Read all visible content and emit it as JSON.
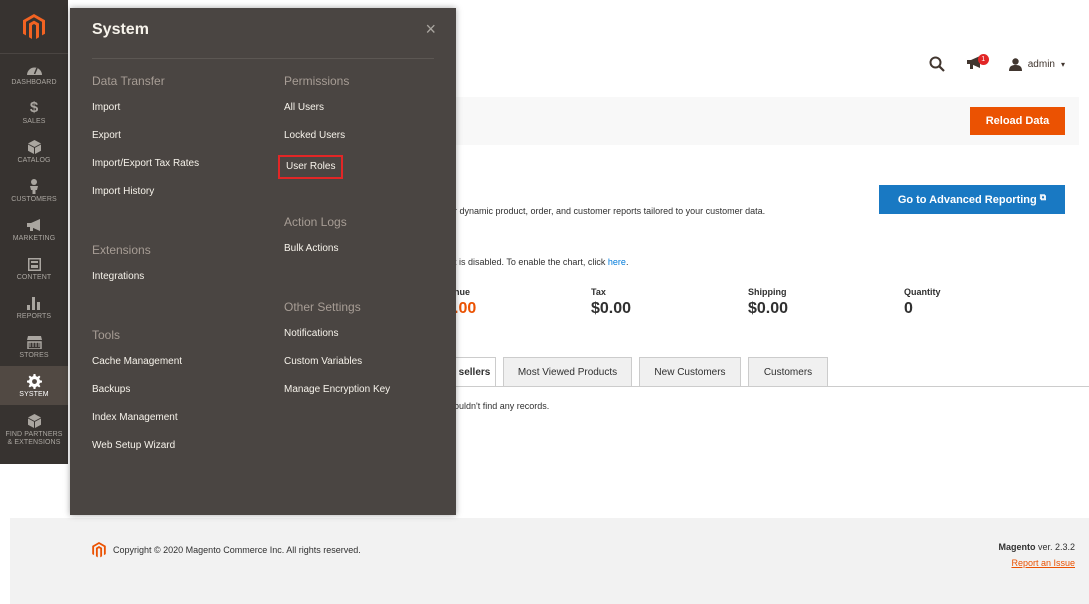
{
  "nav": {
    "items": [
      {
        "label": "DASHBOARD"
      },
      {
        "label": "SALES"
      },
      {
        "label": "CATALOG"
      },
      {
        "label": "CUSTOMERS"
      },
      {
        "label": "MARKETING"
      },
      {
        "label": "CONTENT"
      },
      {
        "label": "REPORTS"
      },
      {
        "label": "STORES"
      },
      {
        "label": "SYSTEM"
      },
      {
        "label": "FIND PARTNERS & EXTENSIONS"
      }
    ],
    "sales_glyph": "$"
  },
  "flyout": {
    "title": "System",
    "close_glyph": "×",
    "col1": {
      "data_transfer": {
        "title": "Data Transfer",
        "links": [
          "Import",
          "Export",
          "Import/Export Tax Rates",
          "Import History"
        ]
      },
      "extensions": {
        "title": "Extensions",
        "links": [
          "Integrations"
        ]
      },
      "tools": {
        "title": "Tools",
        "links": [
          "Cache Management",
          "Backups",
          "Index Management",
          "Web Setup Wizard"
        ]
      }
    },
    "col2": {
      "permissions": {
        "title": "Permissions",
        "links": [
          "All Users",
          "Locked Users",
          "User Roles"
        ]
      },
      "action_logs": {
        "title": "Action Logs",
        "links": [
          "Bulk Actions"
        ]
      },
      "other_settings": {
        "title": "Other Settings",
        "links": [
          "Notifications",
          "Custom Variables",
          "Manage Encryption Key"
        ]
      }
    }
  },
  "header": {
    "notification_count": "1",
    "user": "admin",
    "user_caret": "▾"
  },
  "toolbar": {
    "reload_label": "Reload Data"
  },
  "content": {
    "advanced_reporting_label": "Go to Advanced Reporting",
    "advanced_reporting_glyph": "⧉",
    "description": "r dynamic product, order, and customer reports tailored to your customer data.",
    "chart_msg_prefix": "t is disabled. To enable the chart, click ",
    "chart_msg_link": "here",
    "chart_msg_suffix": ".",
    "stats": [
      {
        "label": "nue",
        "value": ".00"
      },
      {
        "label": "Tax",
        "value": "$0.00"
      },
      {
        "label": "Shipping",
        "value": "$0.00"
      },
      {
        "label": "Quantity",
        "value": "0"
      }
    ],
    "tabs": [
      "sellers",
      "Most Viewed Products",
      "New Customers",
      "Customers"
    ],
    "no_records": "ouldn't find any records."
  },
  "footer": {
    "copyright": "Copyright © 2020 Magento Commerce Inc. All rights reserved.",
    "brand": "Magento",
    "version": " ver. 2.3.2",
    "report_issue": "Report an Issue"
  },
  "colors": {
    "nav_bg": "#373330",
    "flyout_bg": "#4a4542",
    "accent_orange": "#eb5202",
    "accent_blue": "#1979c3",
    "highlight_red": "#e22626"
  }
}
